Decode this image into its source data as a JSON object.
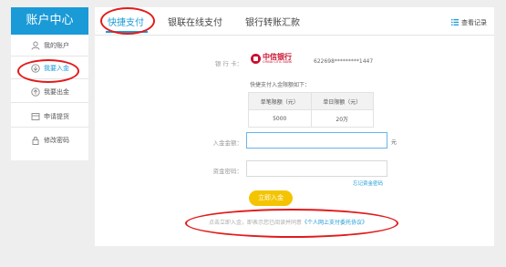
{
  "sidebar": {
    "title": "账户中心",
    "items": [
      {
        "label": "我的账户",
        "icon": "user-icon"
      },
      {
        "label": "我要入金",
        "icon": "deposit-icon"
      },
      {
        "label": "我要出金",
        "icon": "withdraw-icon"
      },
      {
        "label": "申请提货",
        "icon": "pickup-icon"
      },
      {
        "label": "修改密码",
        "icon": "lock-icon"
      }
    ]
  },
  "tabs": [
    "快捷支付",
    "银联在线支付",
    "银行转账汇款"
  ],
  "records_label": "查看记录",
  "form": {
    "bank_label": "银 行 卡：",
    "bank_name": "中信银行",
    "bank_name_en": "CHINA CITIC BANK",
    "card_number": "622698*********1447",
    "limit_title": "快捷支付入金限额如下：",
    "limit_headers": [
      "单笔限额（元）",
      "单日限额（元）"
    ],
    "limit_values": [
      "5000",
      "20万"
    ],
    "amount_label": "入金金额：",
    "amount_value": "",
    "amount_unit": "元",
    "password_label": "资金密码：",
    "password_value": "",
    "forgot_password": "忘记资金密码",
    "submit_label": "立即入金",
    "agreement_prefix": "点击立即入金，即表示您已阅读并同意",
    "agreement_link": "《个人网上支付委托协议》"
  },
  "colors": {
    "accent": "#1a9ad6",
    "button": "#f5c400",
    "annotation": "#e21b1b",
    "bank_red": "#c8102e"
  }
}
